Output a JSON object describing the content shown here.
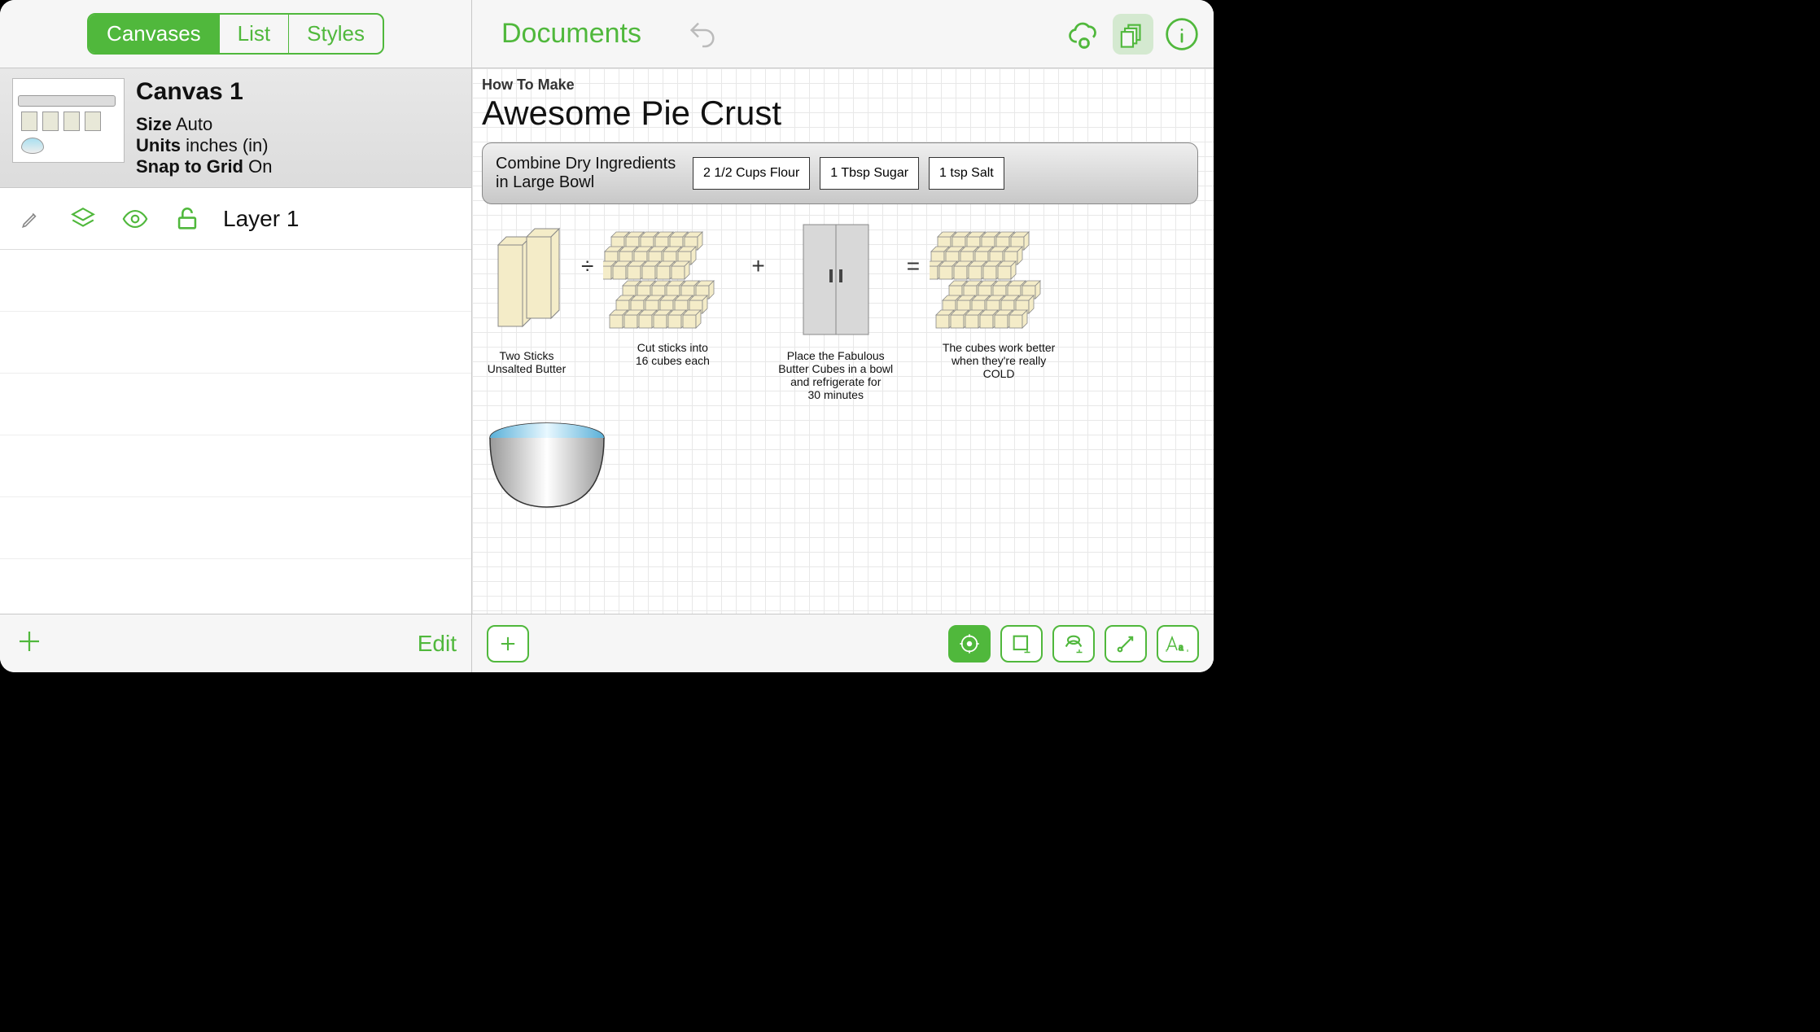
{
  "tabs": {
    "canvases": "Canvases",
    "list": "List",
    "styles": "Styles"
  },
  "canvas": {
    "title": "Canvas 1",
    "size_label": "Size",
    "size_value": "Auto",
    "units_label": "Units",
    "units_value": "inches (in)",
    "snap_label": "Snap to Grid",
    "snap_value": "On"
  },
  "layer": {
    "name": "Layer 1"
  },
  "left_bottom": {
    "edit": "Edit"
  },
  "header": {
    "documents": "Documents"
  },
  "doc": {
    "subtitle": "How To Make",
    "title": "Awesome Pie Crust",
    "step_text": "Combine Dry Ingredients in Large Bowl",
    "ingredients": [
      "2 1/2 Cups Flour",
      "1 Tbsp Sugar",
      "1 tsp Salt"
    ],
    "captions": {
      "butter": "Two Sticks\nUnsalted Butter",
      "cut": "Cut sticks into\n16 cubes each",
      "fridge": "Place the Fabulous Butter Cubes in a bowl and refrigerate for\n30 minutes",
      "cold": "The cubes work better when they're really COLD"
    },
    "ops": {
      "divide": "÷",
      "plus": "+",
      "equals": "="
    }
  }
}
